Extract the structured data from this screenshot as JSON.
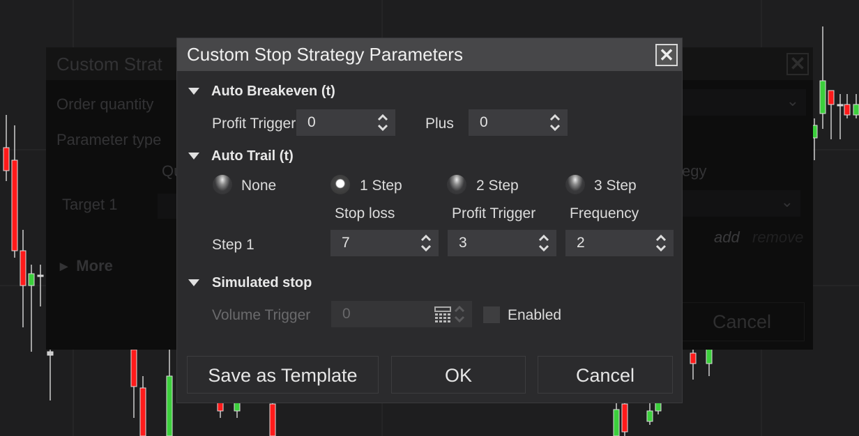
{
  "background_dialog": {
    "title": "Custom Strat",
    "order_quantity_label": "Order quantity",
    "parameter_type_label": "Parameter type",
    "column_partial": "Qu",
    "strategy_partial": "egy",
    "target_label": "Target 1",
    "more_label": "More",
    "add_link": "add",
    "remove_link": "remove",
    "cancel_label": "Cancel"
  },
  "dialog": {
    "title": "Custom Stop Strategy Parameters",
    "auto_breakeven": {
      "header": "Auto Breakeven (t)",
      "profit_trigger_label": "Profit Trigger",
      "profit_trigger_value": "0",
      "plus_label": "Plus",
      "plus_value": "0"
    },
    "auto_trail": {
      "header": "Auto Trail (t)",
      "options": [
        "None",
        "1 Step",
        "2 Step",
        "3 Step"
      ],
      "selected": "1 Step",
      "columns": [
        "Stop loss",
        "Profit Trigger",
        "Frequency"
      ],
      "step_label": "Step 1",
      "step_values": [
        "7",
        "3",
        "2"
      ]
    },
    "simulated_stop": {
      "header": "Simulated stop",
      "volume_trigger_label": "Volume Trigger",
      "volume_trigger_value": "0",
      "enabled_label": "Enabled",
      "enabled": false
    },
    "buttons": {
      "save_template": "Save as Template",
      "ok": "OK",
      "cancel": "Cancel"
    }
  },
  "colors": {
    "candle_up": "#3ccf3c",
    "candle_down": "#ff1a1a",
    "dialog_bg": "#2b2b2d",
    "title_bar": "#474749"
  }
}
